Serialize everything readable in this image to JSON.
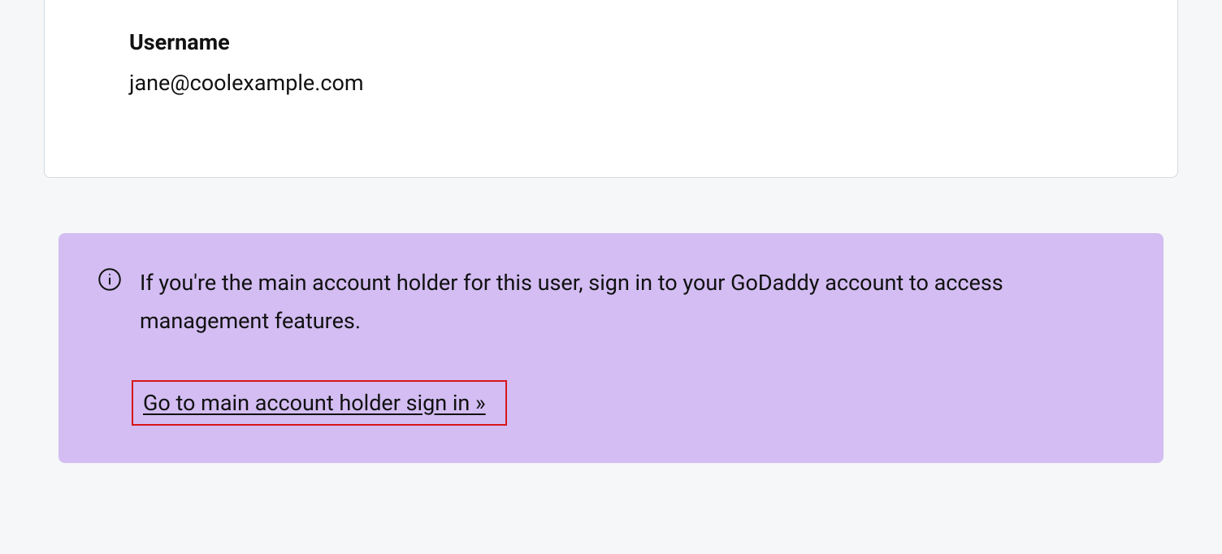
{
  "card": {
    "username_label": "Username",
    "username_value": "jane@coolexample.com"
  },
  "notice": {
    "message": "If you're the main account holder for this user, sign in to your GoDaddy account to access management features.",
    "link_text": "Go to main account holder sign in »"
  }
}
